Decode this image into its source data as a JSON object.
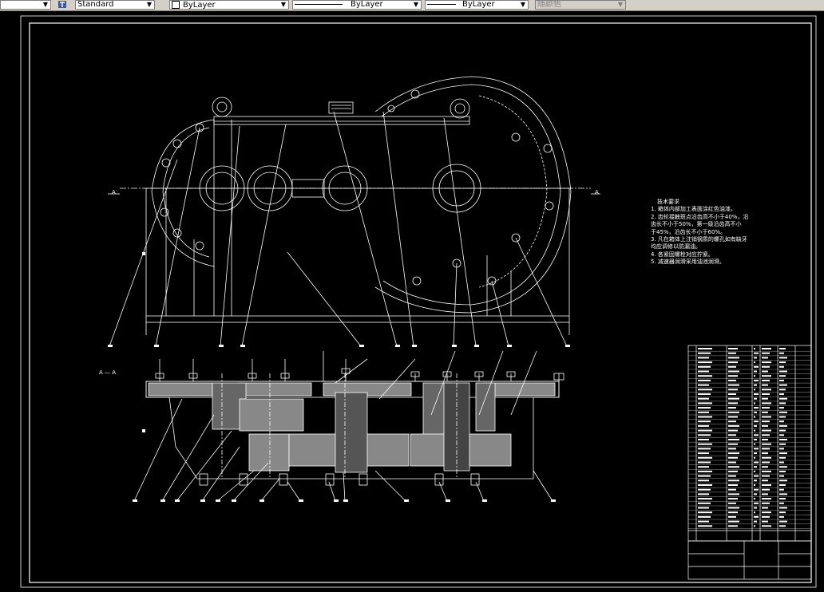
{
  "toolbar": {
    "text_style": "Standard",
    "layer": "ByLayer",
    "linetype": "ByLayer",
    "lineweight": "ByLayer",
    "color": "随颜色"
  },
  "drawing": {
    "section_marker_a_left": "A",
    "section_marker_a_right": "A",
    "section_label": "A — A",
    "tech_requirements": {
      "title": "技术要求",
      "lines": [
        "1. 箱体内部加工表面涂红色油漆。",
        "2. 齿轮接触斑点沿齿高不小于40%，沿",
        "   齿长不小于50%，第一级沿齿高不小",
        "   于45%，沿齿长不小于60%。",
        "3. 凡在箱体上注销钢质的螺孔如有缺牙",
        "   均应调修以防漏油。",
        "4. 各紧固螺栓对应拧紧。",
        "5. 减速器润滑采用油池润滑。"
      ]
    }
  },
  "colors": {
    "background": "#000000",
    "line": "#ffffff",
    "toolbar": "#d4d0c8"
  }
}
